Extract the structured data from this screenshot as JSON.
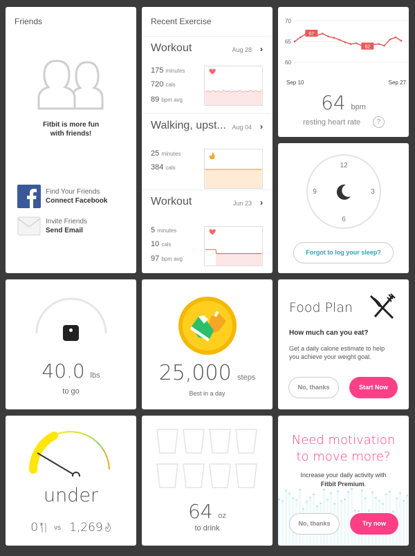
{
  "friends": {
    "title": "Friends",
    "message_line1": "Fitbit is more fun",
    "message_line2": "with friends!",
    "facebook": {
      "line1": "Find Your Friends",
      "line2": "Connect Facebook",
      "icon": "facebook-icon"
    },
    "email": {
      "line1": "Invite Friends",
      "line2": "Send Email",
      "icon": "envelope-icon"
    }
  },
  "exercise": {
    "title": "Recent Exercise",
    "items": [
      {
        "name": "Workout",
        "date": "Aug 28",
        "stats": [
          {
            "v": "175",
            "u": "minutes"
          },
          {
            "v": "720",
            "u": "cals"
          },
          {
            "v": "89",
            "u": "bpm avg"
          }
        ],
        "icon": "heart-icon"
      },
      {
        "name": "Walking, upst...",
        "date": "Aug 04",
        "stats": [
          {
            "v": "25",
            "u": "minutes"
          },
          {
            "v": "384",
            "u": "cals"
          }
        ],
        "icon": "flame-icon"
      },
      {
        "name": "Workout",
        "date": "Jun 23",
        "stats": [
          {
            "v": "5",
            "u": "minutes"
          },
          {
            "v": "10",
            "u": "cals"
          },
          {
            "v": "97",
            "u": "bpm avg"
          }
        ],
        "icon": "heart-icon"
      }
    ]
  },
  "heart": {
    "value": "64",
    "unit": "bpm",
    "label": "resting heart rate",
    "help": "?",
    "chart_data": {
      "type": "line",
      "x_start": "Sep 10",
      "x_end": "Sep 27",
      "y_ticks": [
        "70",
        "65",
        "60"
      ],
      "ylim": [
        60,
        70
      ],
      "values": [
        65.0,
        66.0,
        66.8,
        67.0,
        66.5,
        66.9,
        66.2,
        65.9,
        65.4,
        64.8,
        64.4,
        64.6,
        64.0,
        63.9,
        64.3,
        64.4,
        64.0,
        65.5,
        66.0,
        65.2
      ],
      "max_label": "67",
      "min_label": "62",
      "line_color": "#e85a5a"
    }
  },
  "sleep": {
    "clock": [
      "12",
      "3",
      "6",
      "9"
    ],
    "icon": "moon-icon",
    "button": "Forgot to log your sleep?",
    "accent": "#2aa6b5"
  },
  "weight": {
    "value": "40.0",
    "unit": "lbs",
    "label": "to go",
    "icon": "scale-icon"
  },
  "steps": {
    "value": "25,000",
    "unit": "steps",
    "label": "Best in a day",
    "icon": "shoe-badge-icon"
  },
  "food": {
    "title": "Food Plan",
    "question": "How much can you eat?",
    "desc_line1": "Get a daily calorie estimate to help",
    "desc_line2": "you achieve your weight goal.",
    "no_button": "No, thanks",
    "yes_button": "Start Now",
    "accent": "#ff3f86",
    "icon": "fork-knife-icon"
  },
  "calories": {
    "status": "under",
    "food_value": "0",
    "vs": "vs",
    "burned_value": "1,269",
    "food_icon": "fork-knife-icon",
    "burn_icon": "flame-icon"
  },
  "water": {
    "value": "64",
    "unit": "oz",
    "label": "to drink",
    "icon": "glass-icon"
  },
  "motivation": {
    "title_line1": "Need motivation",
    "title_line2": "to move more?",
    "desc_line1": "Increase your daily activity with",
    "desc_premium": "Fitbit Premium",
    "desc_end": ".",
    "no_button": "No, thanks",
    "yes_button": "Try now",
    "accent": "#ff3f86"
  }
}
